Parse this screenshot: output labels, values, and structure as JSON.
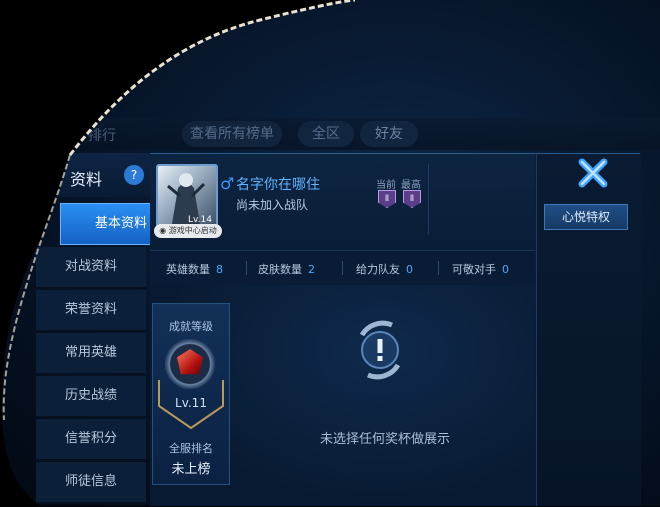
{
  "topbar": {
    "title_fragment": "排行",
    "view_all": "查看所有榜单",
    "region": "全区",
    "friends": "好友"
  },
  "sidebar": {
    "title": "资料",
    "help": "?",
    "items": [
      {
        "label": "基本资料",
        "active": true
      },
      {
        "label": "对战资料"
      },
      {
        "label": "荣誉资料"
      },
      {
        "label": "常用英雄"
      },
      {
        "label": "历史战绩"
      },
      {
        "label": "信誉积分"
      },
      {
        "label": "师徒信息"
      }
    ]
  },
  "profile": {
    "name": "名字你在哪住",
    "gender_icon": "♂",
    "team_status": "尚未加入战队",
    "game_center": "游戏中心启动",
    "avatar_level": "Lv.14",
    "rank_current_label": "当前",
    "rank_best_label": "最高",
    "rank_current": "Ⅱ",
    "rank_best": "Ⅱ"
  },
  "stats": [
    {
      "label": "英雄数量",
      "value": "8"
    },
    {
      "label": "皮肤数量",
      "value": "2"
    },
    {
      "label": "给力队友",
      "value": "0"
    },
    {
      "label": "可敬对手",
      "value": "0"
    }
  ],
  "achievement": {
    "title": "成就等级",
    "level": "Lv.11",
    "server_rank_label": "全服排名",
    "server_rank_value": "未上榜"
  },
  "trophy": {
    "empty_message": "未选择任何奖杯做展示"
  },
  "right": {
    "vip_tab": "心悦特权"
  },
  "colors": {
    "accent": "#2b8ef3",
    "name": "#5eb4ff",
    "stat_value": "#4ea7ff",
    "background": "#081a31"
  }
}
